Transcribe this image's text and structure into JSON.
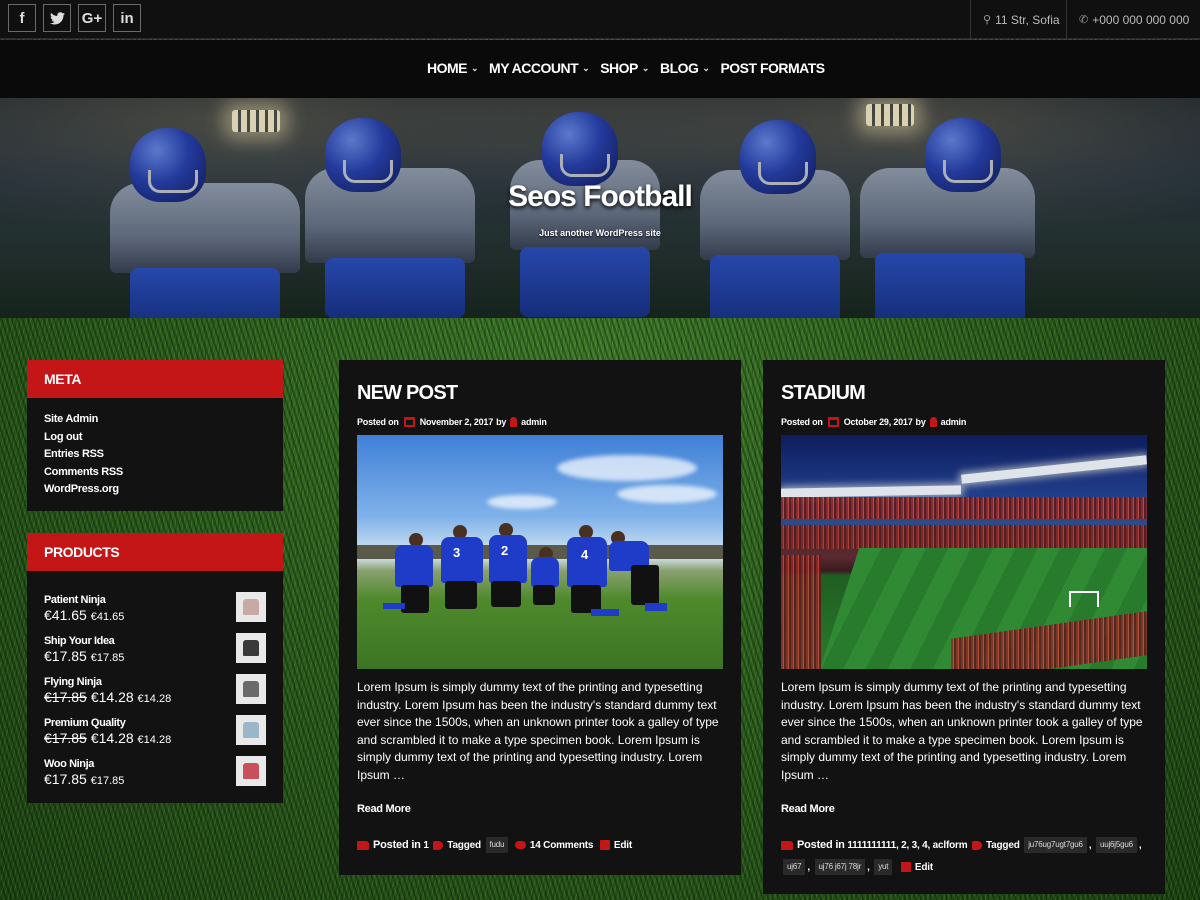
{
  "topbar": {
    "social": [
      {
        "icon": "facebook-icon",
        "glyph": "f"
      },
      {
        "icon": "twitter-icon",
        "glyph": "t"
      },
      {
        "icon": "google-plus-icon",
        "glyph": "G+"
      },
      {
        "icon": "linkedin-icon",
        "glyph": "in"
      }
    ],
    "address": "11 Str, Sofia",
    "phone": "+000 000 000 000"
  },
  "nav": {
    "items": [
      {
        "label": "HOME",
        "dropdown": true
      },
      {
        "label": "MY ACCOUNT",
        "dropdown": true
      },
      {
        "label": "SHOP",
        "dropdown": true
      },
      {
        "label": "BLOG",
        "dropdown": true
      },
      {
        "label": "POST FORMATS",
        "dropdown": false
      }
    ]
  },
  "hero": {
    "title": "Seos Football",
    "tagline": "Just another WordPress site"
  },
  "sidebar": {
    "meta": {
      "title": "META",
      "links": [
        "Site Admin",
        "Log out",
        "Entries RSS",
        "Comments RSS",
        "WordPress.org"
      ]
    },
    "products": {
      "title": "PRODUCTS",
      "items": [
        {
          "name": "Patient Ninja",
          "old_price": "",
          "price": "€41.65",
          "price_small": "€41.65",
          "shirt_color": "#c9a9a6"
        },
        {
          "name": "Ship Your Idea",
          "old_price": "",
          "price": "€17.85",
          "price_small": "€17.85",
          "shirt_color": "#3a3a3a"
        },
        {
          "name": "Flying Ninja",
          "old_price": "€17.85",
          "price": "€14.28",
          "price_small": "€14.28",
          "shirt_color": "#6a6a6a"
        },
        {
          "name": "Premium Quality",
          "old_price": "€17.85",
          "price": "€14.28",
          "price_small": "€14.28",
          "shirt_color": "#9ab6c8"
        },
        {
          "name": "Woo Ninja",
          "old_price": "",
          "price": "€17.85",
          "price_small": "€17.85",
          "shirt_color": "#c8505a"
        }
      ]
    }
  },
  "posts": [
    {
      "title": "NEW POST",
      "posted_on": "Posted on",
      "date": "November 2, 2017",
      "by": "by",
      "author": "admin",
      "excerpt": "Lorem Ipsum is simply dummy text of the printing and typesetting industry. Lorem Ipsum has been the industry's standard dummy text ever since the 1500s, when an unknown printer took a galley of type and scrambled it to make a type specimen book. Lorem Ipsum is simply dummy text of the printing and typesetting industry. Lorem Ipsum …",
      "read_more": "Read More",
      "posted_in_label": "Posted in",
      "categories": "1",
      "tagged_label": "Tagged",
      "tags": [
        "fudu"
      ],
      "comments": "14 Comments",
      "edit": "Edit"
    },
    {
      "title": "STADIUM",
      "posted_on": "Posted on",
      "date": "October 29, 2017",
      "by": "by",
      "author": "admin",
      "excerpt": "Lorem Ipsum is simply dummy text of the printing and typesetting industry. Lorem Ipsum has been the industry's standard dummy text ever since the 1500s, when an unknown printer took a galley of type and scrambled it to make a type specimen book. Lorem Ipsum is simply dummy text of the printing and typesetting industry. Lorem Ipsum …",
      "read_more": "Read More",
      "posted_in_label": "Posted in",
      "categories": "1111111111, 2, 3, 4, aclform",
      "tagged_label": "Tagged",
      "tags": [
        "ju76ug7ugt7gu6",
        "uuj6j5gu6",
        "uj67",
        "uj76 j67j 78jr",
        "yut"
      ],
      "comments": "",
      "edit": "Edit"
    }
  ],
  "colors": {
    "accent": "#c41616",
    "panel": "#121212",
    "topbar": "#101010"
  }
}
